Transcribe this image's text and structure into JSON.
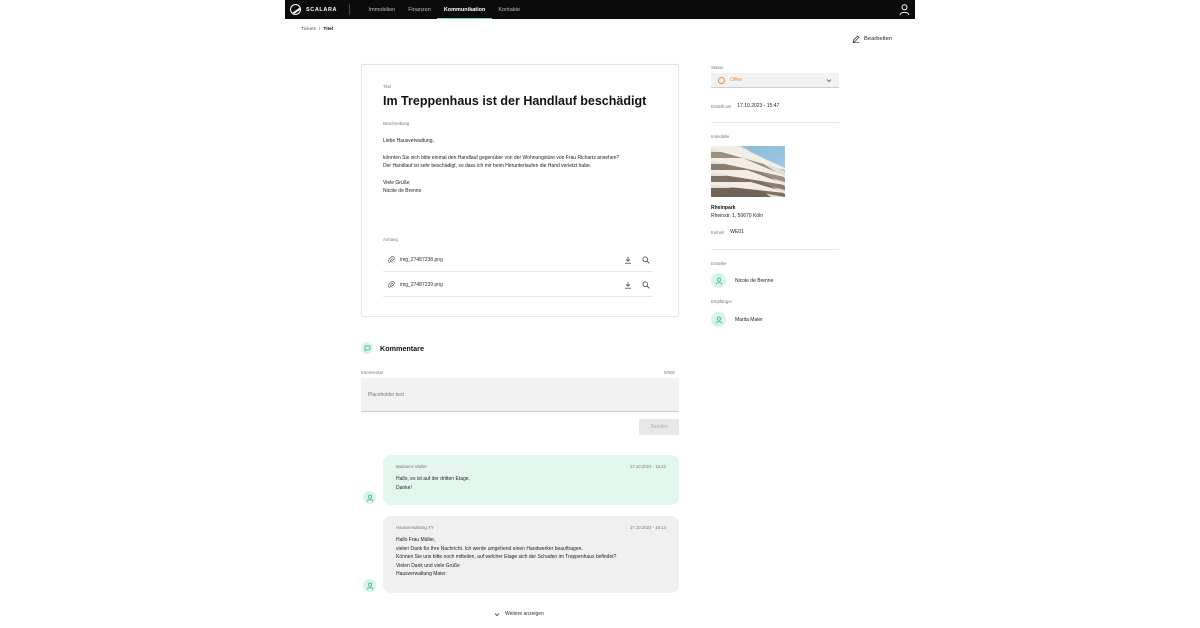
{
  "colors": {
    "accent": "#6fd6b4",
    "status": "#e8913b",
    "nav_bg": "#0b0b0b",
    "bubble_green": "#e4f7ef",
    "bubble_grey": "#f0f0f0"
  },
  "brand": {
    "name": "SCALARA",
    "icon": "scalara-logo-icon"
  },
  "nav": {
    "items": [
      "Immobilien",
      "Finanzen",
      "Kommunikation",
      "Kontakte"
    ],
    "active": "Kommunikation"
  },
  "breadcrumb": {
    "parent": "Tickets",
    "separator": "/",
    "current": "Titel"
  },
  "toolbar": {
    "edit_label": "Bearbeiten"
  },
  "ticket": {
    "title_label": "Titel",
    "title": "Im Treppenhaus ist der Handlauf beschädigt",
    "description_label": "Beschreibung",
    "description_lines": [
      "Liebe Hausverwaltung,",
      "könnten Sie sich bitte einmal den Handlauf gegenüber von der Wohnungstüre von Frau Richartz ansehen?",
      "Der Handlauf ist sehr beschädigt, so dass ich mir beim Herunterlaufen die Hand verletzt habe.",
      "Viele Grüße",
      "Nicole de Brenne"
    ],
    "attachments_label": "Anhang",
    "attachments": [
      "img_27487238.png",
      "img_27487239.png"
    ]
  },
  "comments": {
    "title": "Kommentare",
    "field_label": "Kommentar",
    "counter": "0/500",
    "placeholder": "Placeholder text",
    "send_label": "Senden",
    "items": [
      {
        "author": "Marianne Müller",
        "time": "17.10.2023 - 16:43",
        "lines": [
          "Hallo, es ist auf der dritten Etage.",
          "Danke!"
        ]
      },
      {
        "author": "Hausverwaltung XY",
        "time": "17.10.2023 - 16:14",
        "lines": [
          "Hallo Frau Müller,",
          "vielen Dank für Ihre Nachricht. Ich werde umgehend einen Handwerker beauftragen.",
          "Können Sie uns bitte noch mitteilen, auf welcher Etage sich der Schaden im Treppenhaus befindet?",
          "Vielen Dank und viele Grüße",
          "Hausverwaltung Maier"
        ]
      }
    ],
    "more_label": "Weitere anzeigen"
  },
  "sidebar": {
    "status_label": "Status",
    "status_value": "Offen",
    "created_label": "Erstellt am",
    "created_value": "17.10.2023 - 15:47",
    "property_label": "Immobilie",
    "property_name": "Rheinpark",
    "property_address": "Rheinstr. 1, 50670 Köln",
    "unit_label": "Einheit",
    "unit_value": "WE01",
    "creator_label": "Ersteller",
    "creator_name": "Nicole de Brenne",
    "recipient_label": "Empfänger",
    "recipient_name": "Marita Maier"
  }
}
